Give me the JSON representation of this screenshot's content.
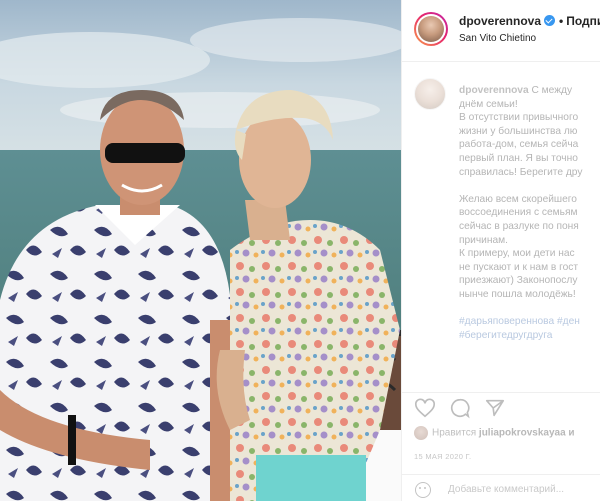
{
  "post": {
    "username": "dpoverennova",
    "follow_label": "Подпи",
    "location": "San Vito Chietino"
  },
  "caption": {
    "username": "dpoverennova",
    "lines_first": [
      "С между",
      "днём семьи!"
    ],
    "lines": [
      "В отсутствии привычного",
      "жизни у большинства лю",
      "работа-дом, семья сейча",
      "первый план. Я вы точно",
      "справилась! Берегите дру"
    ],
    "lines2": [
      "Желаю всем скорейшего",
      "воссоединения с семьям",
      "сейчас в разлуке по поня",
      "причинам.",
      "К примеру, мои дети нас",
      "не пускают и к нам в гост",
      "приезжают) Законопослу",
      "нынче пошла молодёжь!"
    ],
    "hashtags": [
      "#дарьяповереннова #ден",
      "#берегитедругдруга"
    ]
  },
  "likes": {
    "prefix": "Нравится",
    "user": "juliapokrovskayaa и"
  },
  "date": "15 МАЯ 2020 Г.",
  "comment_placeholder": "Добавьте комментарий...",
  "icons": [
    "heart-icon",
    "comment-icon",
    "share-icon",
    "verified-icon",
    "emoji-icon"
  ],
  "colors": {
    "accent_verified": "#3897f0",
    "ring_start": "#f9a14a",
    "ring_end": "#c229a9"
  }
}
